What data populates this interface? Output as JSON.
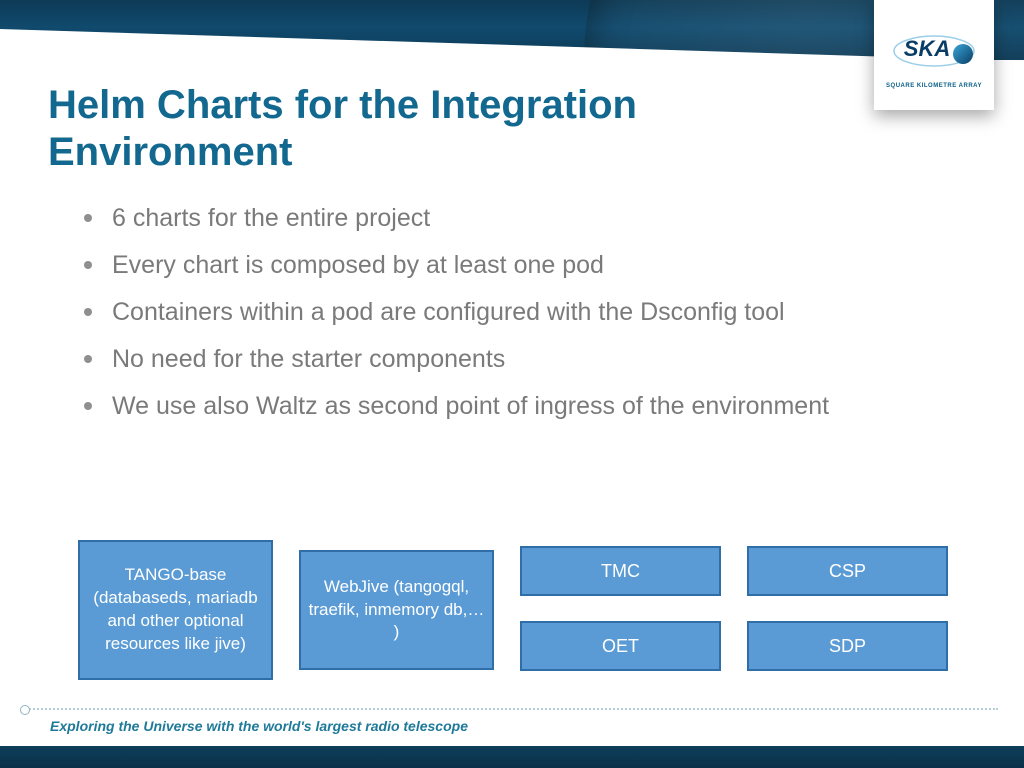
{
  "logo": {
    "text": "SKA",
    "subtitle": "SQUARE KILOMETRE ARRAY"
  },
  "title": "Helm Charts for the Integration Environment",
  "bullets": [
    "6 charts for the entire project",
    "Every chart is composed by at least one pod",
    "Containers within a pod are configured with the Dsconfig tool",
    "No need for the starter components",
    "We use also Waltz as second point of ingress of the environment"
  ],
  "boxes": {
    "tango_base": "TANGO-base (databaseds, mariadb and other optional resources like jive)",
    "webjive": "WebJive (tangogql, traefik, inmemory db,… )",
    "tmc": "TMC",
    "csp": "CSP",
    "oet": "OET",
    "sdp": "SDP"
  },
  "footer": {
    "tagline": "Exploring the Universe with the world's largest radio telescope"
  }
}
